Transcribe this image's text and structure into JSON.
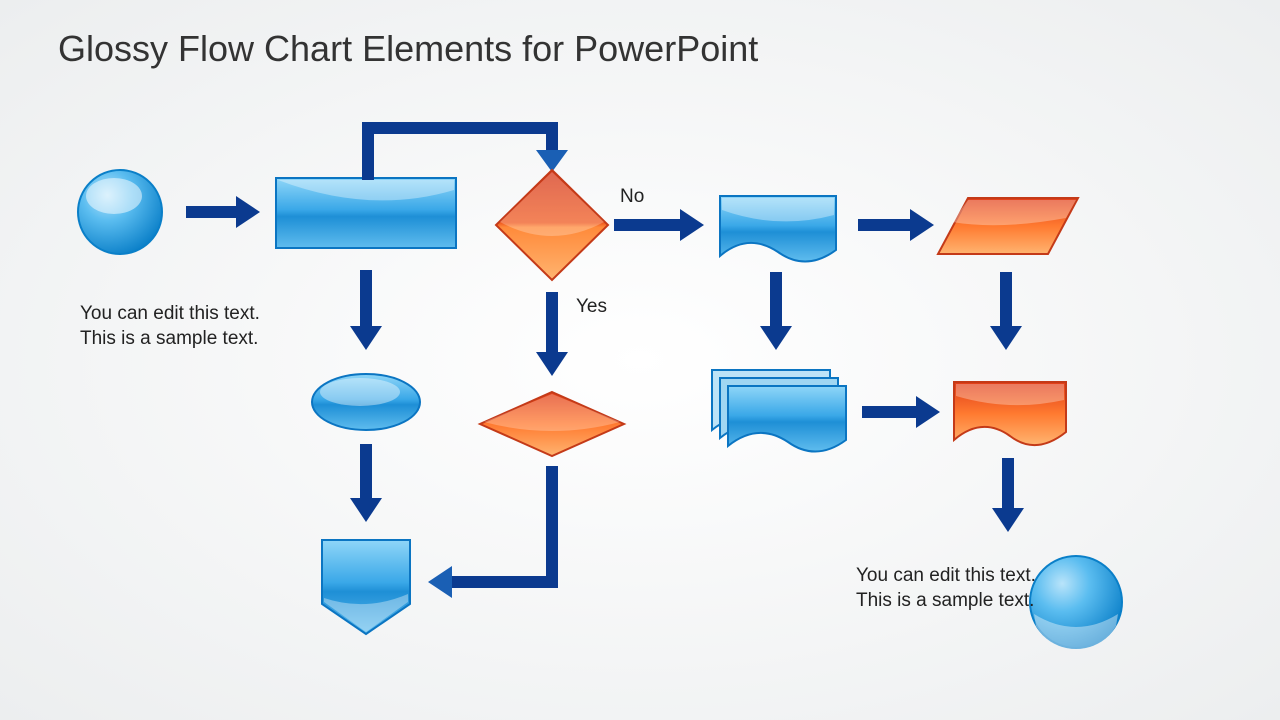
{
  "title": "Glossy Flow Chart Elements for PowerPoint",
  "sample_text_left": "You can edit this text. This is a sample text.",
  "sample_text_right": "You can edit this text. This is a sample text.",
  "labels": {
    "no": "No",
    "yes": "Yes"
  },
  "colors": {
    "blue_light": "#6fc8f6",
    "blue_mid": "#2a9de0",
    "blue_dark": "#0b75c2",
    "orange_light": "#ff9a4a",
    "red_dark": "#d43517",
    "arrow": "#0b3a8f"
  }
}
